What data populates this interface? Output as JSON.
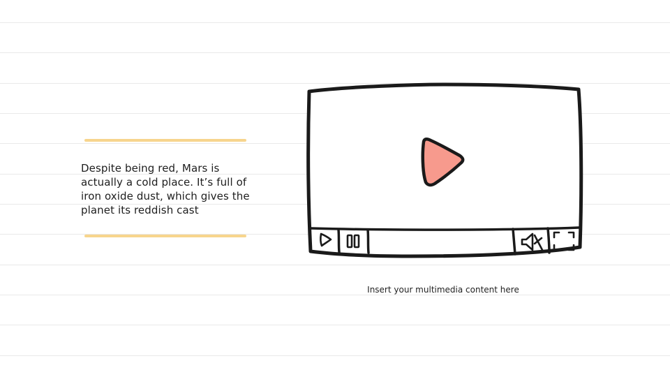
{
  "slide": {
    "body_text": "Despite being red, Mars is actually a cold place. It’s full of iron oxide dust, which gives the planet its reddish cast",
    "caption": "Insert your multimedia content here"
  },
  "video_player": {
    "icons": {
      "center": "play-icon",
      "play": "play-icon",
      "pause": "pause-icon",
      "volume": "mute-icon",
      "fullscreen": "fullscreen-icon"
    }
  },
  "colors": {
    "accent_play": "#f79a8d",
    "highlight": "#f7d58d",
    "outline": "#1a1a1a",
    "ruled_line": "#e9e9e9"
  }
}
